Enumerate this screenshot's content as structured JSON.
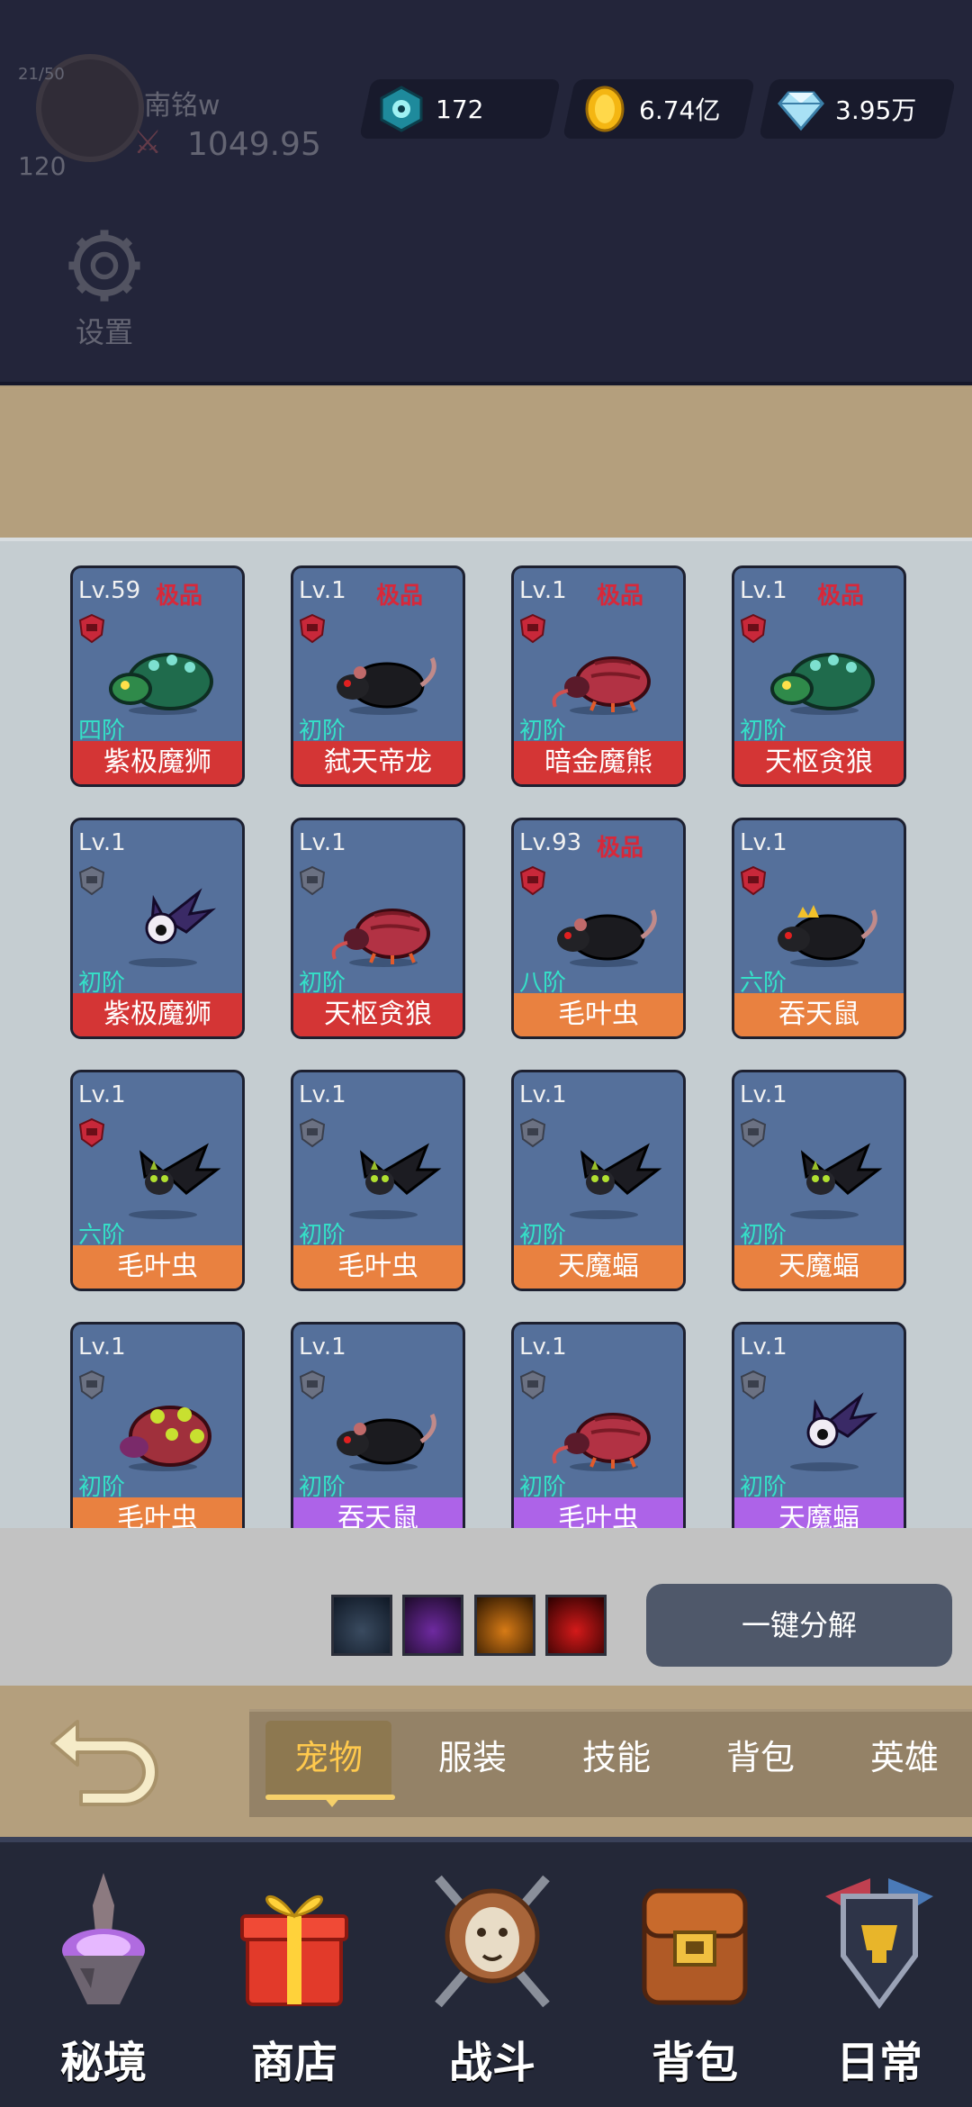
{
  "profile": {
    "level_small": "21/50",
    "level_big": "120",
    "name": "南铭w",
    "power": "1049.95"
  },
  "settings": {
    "label": "设置"
  },
  "currencies": {
    "gem": "172",
    "gold": "6.74亿",
    "diamond": "3.95万"
  },
  "colors": {
    "name_red": "#d43535",
    "name_orange": "#e98140",
    "name_purple": "#ad63e8",
    "quality_red": "#d7283a",
    "tier_cyan": "#35e0c8",
    "card_blue": "#55709b"
  },
  "pets": [
    {
      "level": "Lv.59",
      "quality": "极品",
      "badge": "red",
      "tier": "四阶",
      "name": "紫极魔狮",
      "name_color": "red",
      "sprite": "green-turtle"
    },
    {
      "level": "Lv.1",
      "quality": "极品",
      "badge": "red",
      "tier": "初阶",
      "name": "弑天帝龙",
      "name_color": "red",
      "sprite": "black-rat"
    },
    {
      "level": "Lv.1",
      "quality": "极品",
      "badge": "red",
      "tier": "初阶",
      "name": "暗金魔熊",
      "name_color": "red",
      "sprite": "red-bug"
    },
    {
      "level": "Lv.1",
      "quality": "极品",
      "badge": "red",
      "tier": "初阶",
      "name": "天枢贪狼",
      "name_color": "red",
      "sprite": "green-turtle"
    },
    {
      "level": "Lv.1",
      "quality": "",
      "badge": "grey",
      "tier": "初阶",
      "name": "紫极魔狮",
      "name_color": "red",
      "sprite": "eyeball-bat"
    },
    {
      "level": "Lv.1",
      "quality": "",
      "badge": "grey",
      "tier": "初阶",
      "name": "天枢贪狼",
      "name_color": "red",
      "sprite": "red-bug"
    },
    {
      "level": "Lv.93",
      "quality": "极品",
      "badge": "red",
      "tier": "八阶",
      "name": "毛叶虫",
      "name_color": "orange",
      "sprite": "black-rat"
    },
    {
      "level": "Lv.1",
      "quality": "",
      "badge": "red",
      "tier": "六阶",
      "name": "吞天鼠",
      "name_color": "orange",
      "sprite": "crowned-rat"
    },
    {
      "level": "Lv.1",
      "quality": "",
      "badge": "red",
      "tier": "六阶",
      "name": "毛叶虫",
      "name_color": "orange",
      "sprite": "black-bat"
    },
    {
      "level": "Lv.1",
      "quality": "",
      "badge": "grey",
      "tier": "初阶",
      "name": "毛叶虫",
      "name_color": "orange",
      "sprite": "black-bat"
    },
    {
      "level": "Lv.1",
      "quality": "",
      "badge": "grey",
      "tier": "初阶",
      "name": "天魔蝠",
      "name_color": "orange",
      "sprite": "black-bat"
    },
    {
      "level": "Lv.1",
      "quality": "",
      "badge": "grey",
      "tier": "初阶",
      "name": "天魔蝠",
      "name_color": "orange",
      "sprite": "black-bat"
    },
    {
      "level": "Lv.1",
      "quality": "",
      "badge": "grey",
      "tier": "初阶",
      "name": "毛叶虫",
      "name_color": "orange",
      "sprite": "spotted-beetle"
    },
    {
      "level": "Lv.1",
      "quality": "",
      "badge": "grey",
      "tier": "初阶",
      "name": "吞天鼠",
      "name_color": "purple",
      "sprite": "black-rat"
    },
    {
      "level": "Lv.1",
      "quality": "",
      "badge": "grey",
      "tier": "初阶",
      "name": "毛叶虫",
      "name_color": "purple",
      "sprite": "red-bug"
    },
    {
      "level": "Lv.1",
      "quality": "",
      "badge": "grey",
      "tier": "初阶",
      "name": "天魔蝠",
      "name_color": "purple",
      "sprite": "eyeball-bat"
    }
  ],
  "decompose": {
    "button_label": "一键分解",
    "filters": [
      "blue-quality-filter",
      "purple-quality-filter",
      "orange-quality-filter",
      "red-quality-filter"
    ]
  },
  "tabs": [
    {
      "label": "宠物",
      "active": true
    },
    {
      "label": "服装",
      "active": false
    },
    {
      "label": "技能",
      "active": false
    },
    {
      "label": "背包",
      "active": false
    },
    {
      "label": "英雄",
      "active": false
    }
  ],
  "nav": [
    {
      "label": "秘境",
      "icon": "floating-island-icon"
    },
    {
      "label": "商店",
      "icon": "gift-box-icon"
    },
    {
      "label": "战斗",
      "icon": "lion-crest-icon"
    },
    {
      "label": "背包",
      "icon": "leather-bag-icon"
    },
    {
      "label": "日常",
      "icon": "shield-emblem-icon"
    }
  ]
}
